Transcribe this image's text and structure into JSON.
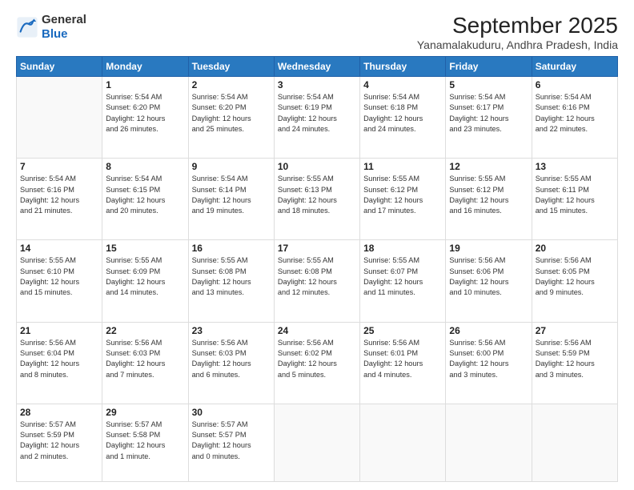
{
  "logo": {
    "general": "General",
    "blue": "Blue"
  },
  "title": "September 2025",
  "subtitle": "Yanamalakuduru, Andhra Pradesh, India",
  "days": [
    "Sunday",
    "Monday",
    "Tuesday",
    "Wednesday",
    "Thursday",
    "Friday",
    "Saturday"
  ],
  "weeks": [
    [
      {
        "num": "",
        "detail": ""
      },
      {
        "num": "1",
        "detail": "Sunrise: 5:54 AM\nSunset: 6:20 PM\nDaylight: 12 hours\nand 26 minutes."
      },
      {
        "num": "2",
        "detail": "Sunrise: 5:54 AM\nSunset: 6:20 PM\nDaylight: 12 hours\nand 25 minutes."
      },
      {
        "num": "3",
        "detail": "Sunrise: 5:54 AM\nSunset: 6:19 PM\nDaylight: 12 hours\nand 24 minutes."
      },
      {
        "num": "4",
        "detail": "Sunrise: 5:54 AM\nSunset: 6:18 PM\nDaylight: 12 hours\nand 24 minutes."
      },
      {
        "num": "5",
        "detail": "Sunrise: 5:54 AM\nSunset: 6:17 PM\nDaylight: 12 hours\nand 23 minutes."
      },
      {
        "num": "6",
        "detail": "Sunrise: 5:54 AM\nSunset: 6:16 PM\nDaylight: 12 hours\nand 22 minutes."
      }
    ],
    [
      {
        "num": "7",
        "detail": "Sunrise: 5:54 AM\nSunset: 6:16 PM\nDaylight: 12 hours\nand 21 minutes."
      },
      {
        "num": "8",
        "detail": "Sunrise: 5:54 AM\nSunset: 6:15 PM\nDaylight: 12 hours\nand 20 minutes."
      },
      {
        "num": "9",
        "detail": "Sunrise: 5:54 AM\nSunset: 6:14 PM\nDaylight: 12 hours\nand 19 minutes."
      },
      {
        "num": "10",
        "detail": "Sunrise: 5:55 AM\nSunset: 6:13 PM\nDaylight: 12 hours\nand 18 minutes."
      },
      {
        "num": "11",
        "detail": "Sunrise: 5:55 AM\nSunset: 6:12 PM\nDaylight: 12 hours\nand 17 minutes."
      },
      {
        "num": "12",
        "detail": "Sunrise: 5:55 AM\nSunset: 6:12 PM\nDaylight: 12 hours\nand 16 minutes."
      },
      {
        "num": "13",
        "detail": "Sunrise: 5:55 AM\nSunset: 6:11 PM\nDaylight: 12 hours\nand 15 minutes."
      }
    ],
    [
      {
        "num": "14",
        "detail": "Sunrise: 5:55 AM\nSunset: 6:10 PM\nDaylight: 12 hours\nand 15 minutes."
      },
      {
        "num": "15",
        "detail": "Sunrise: 5:55 AM\nSunset: 6:09 PM\nDaylight: 12 hours\nand 14 minutes."
      },
      {
        "num": "16",
        "detail": "Sunrise: 5:55 AM\nSunset: 6:08 PM\nDaylight: 12 hours\nand 13 minutes."
      },
      {
        "num": "17",
        "detail": "Sunrise: 5:55 AM\nSunset: 6:08 PM\nDaylight: 12 hours\nand 12 minutes."
      },
      {
        "num": "18",
        "detail": "Sunrise: 5:55 AM\nSunset: 6:07 PM\nDaylight: 12 hours\nand 11 minutes."
      },
      {
        "num": "19",
        "detail": "Sunrise: 5:56 AM\nSunset: 6:06 PM\nDaylight: 12 hours\nand 10 minutes."
      },
      {
        "num": "20",
        "detail": "Sunrise: 5:56 AM\nSunset: 6:05 PM\nDaylight: 12 hours\nand 9 minutes."
      }
    ],
    [
      {
        "num": "21",
        "detail": "Sunrise: 5:56 AM\nSunset: 6:04 PM\nDaylight: 12 hours\nand 8 minutes."
      },
      {
        "num": "22",
        "detail": "Sunrise: 5:56 AM\nSunset: 6:03 PM\nDaylight: 12 hours\nand 7 minutes."
      },
      {
        "num": "23",
        "detail": "Sunrise: 5:56 AM\nSunset: 6:03 PM\nDaylight: 12 hours\nand 6 minutes."
      },
      {
        "num": "24",
        "detail": "Sunrise: 5:56 AM\nSunset: 6:02 PM\nDaylight: 12 hours\nand 5 minutes."
      },
      {
        "num": "25",
        "detail": "Sunrise: 5:56 AM\nSunset: 6:01 PM\nDaylight: 12 hours\nand 4 minutes."
      },
      {
        "num": "26",
        "detail": "Sunrise: 5:56 AM\nSunset: 6:00 PM\nDaylight: 12 hours\nand 3 minutes."
      },
      {
        "num": "27",
        "detail": "Sunrise: 5:56 AM\nSunset: 5:59 PM\nDaylight: 12 hours\nand 3 minutes."
      }
    ],
    [
      {
        "num": "28",
        "detail": "Sunrise: 5:57 AM\nSunset: 5:59 PM\nDaylight: 12 hours\nand 2 minutes."
      },
      {
        "num": "29",
        "detail": "Sunrise: 5:57 AM\nSunset: 5:58 PM\nDaylight: 12 hours\nand 1 minute."
      },
      {
        "num": "30",
        "detail": "Sunrise: 5:57 AM\nSunset: 5:57 PM\nDaylight: 12 hours\nand 0 minutes."
      },
      {
        "num": "",
        "detail": ""
      },
      {
        "num": "",
        "detail": ""
      },
      {
        "num": "",
        "detail": ""
      },
      {
        "num": "",
        "detail": ""
      }
    ]
  ]
}
